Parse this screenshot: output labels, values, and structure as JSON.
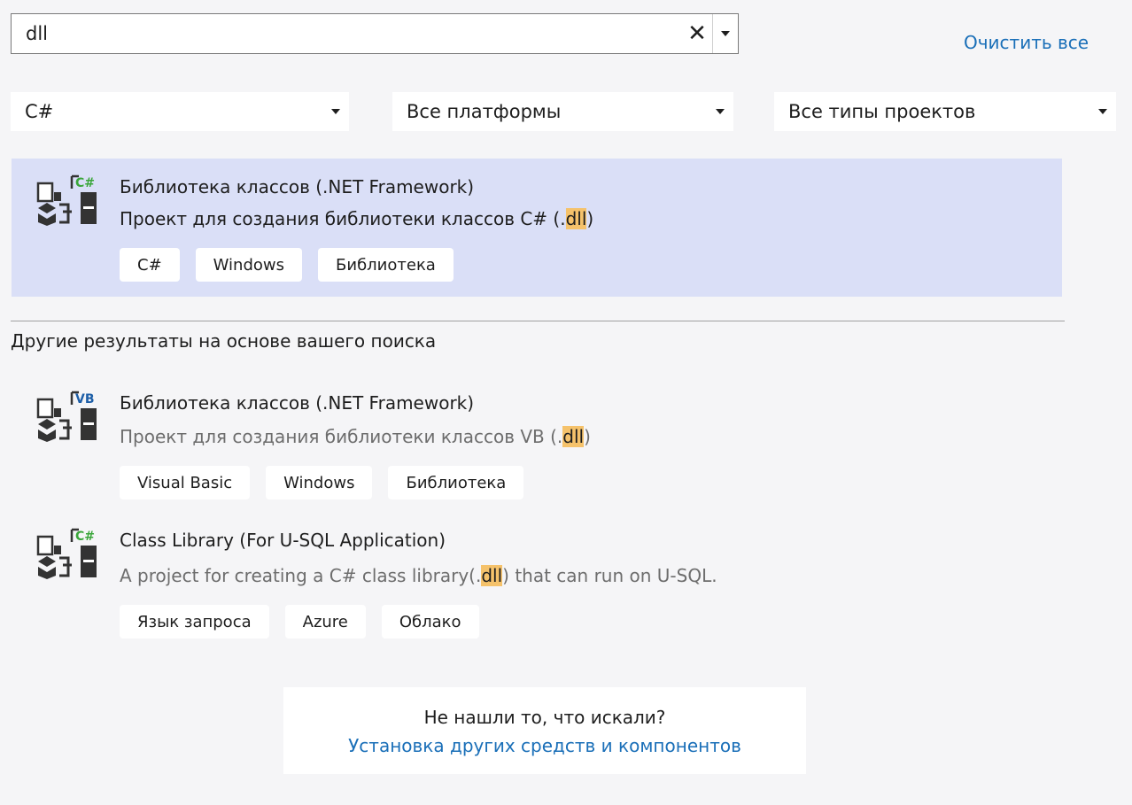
{
  "search": {
    "value": "dll",
    "clear_symbol": "✕"
  },
  "clear_all_label": "Очистить все",
  "filters": {
    "language": "C#",
    "platform": "Все платформы",
    "project_type": "Все типы проектов"
  },
  "top_result": {
    "icon": "class-library-csharp-icon",
    "icon_badge": "C#",
    "title": "Библиотека классов (.NET Framework)",
    "desc_before": "Проект для создания библиотеки классов C# (.",
    "desc_highlight": "dll",
    "desc_after": ")",
    "tags": [
      "C#",
      "Windows",
      "Библиотека"
    ]
  },
  "other_heading": "Другие результаты на основе вашего поиска",
  "other_results": [
    {
      "icon": "class-library-vb-icon",
      "icon_badge": "VB",
      "title": "Библиотека классов (.NET Framework)",
      "desc_before": "Проект для создания библиотеки классов VB (.",
      "desc_highlight": "dll",
      "desc_after": ")",
      "tags": [
        "Visual Basic",
        "Windows",
        "Библиотека"
      ]
    },
    {
      "icon": "class-library-usql-icon",
      "icon_badge": "C#",
      "title": "Class Library (For U-SQL Application)",
      "desc_before": "A project for creating a C# class library(.",
      "desc_highlight": "dll",
      "desc_after": ") that can run on U-SQL.",
      "tags": [
        "Язык запроса",
        "Azure",
        "Облако"
      ]
    }
  ],
  "not_found": {
    "question": "Не нашли то, что искали?",
    "link": "Установка других средств и компонентов"
  },
  "colors": {
    "accent_link": "#1a6fb8",
    "selected_bg": "#dadff7",
    "highlight": "#f5c26b",
    "csharp_badge": "#3aa63a",
    "vb_badge": "#1e5fa8"
  }
}
